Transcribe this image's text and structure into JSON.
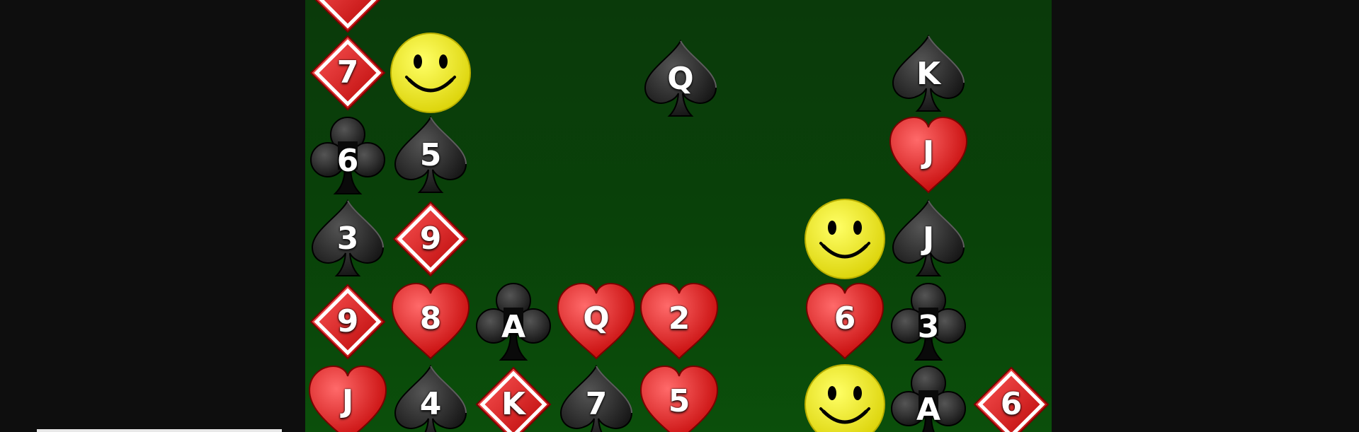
{
  "colors": {
    "felt_top": "#0a3a0a",
    "felt_bottom": "#0b4f0b",
    "red_suit": "#e31b1b",
    "black_suit": "#0a0a0a",
    "smiley": "#f5ee00",
    "backdrop": "#0e0e0e"
  },
  "tiles": [
    {
      "suit": "diamond",
      "rank": "",
      "label": "tile-diamond-offscreen"
    },
    {
      "suit": "diamond",
      "rank": "7"
    },
    {
      "suit": "smiley",
      "rank": ""
    },
    {
      "suit": "spade",
      "rank": "Q"
    },
    {
      "suit": "spade",
      "rank": "K"
    },
    {
      "suit": "club",
      "rank": "6"
    },
    {
      "suit": "spade",
      "rank": "5"
    },
    {
      "suit": "heart",
      "rank": "J"
    },
    {
      "suit": "spade",
      "rank": "3"
    },
    {
      "suit": "diamond",
      "rank": "9"
    },
    {
      "suit": "smiley",
      "rank": ""
    },
    {
      "suit": "spade",
      "rank": "J"
    },
    {
      "suit": "diamond",
      "rank": "9"
    },
    {
      "suit": "heart",
      "rank": "8"
    },
    {
      "suit": "club",
      "rank": "A"
    },
    {
      "suit": "heart",
      "rank": "Q"
    },
    {
      "suit": "heart",
      "rank": "2"
    },
    {
      "suit": "heart",
      "rank": "6"
    },
    {
      "suit": "club",
      "rank": "3"
    },
    {
      "suit": "heart",
      "rank": "J"
    },
    {
      "suit": "spade",
      "rank": "4"
    },
    {
      "suit": "diamond",
      "rank": "K"
    },
    {
      "suit": "spade",
      "rank": "7"
    },
    {
      "suit": "heart",
      "rank": "5"
    },
    {
      "suit": "smiley",
      "rank": ""
    },
    {
      "suit": "club",
      "rank": "A"
    },
    {
      "suit": "diamond",
      "rank": "6"
    }
  ]
}
